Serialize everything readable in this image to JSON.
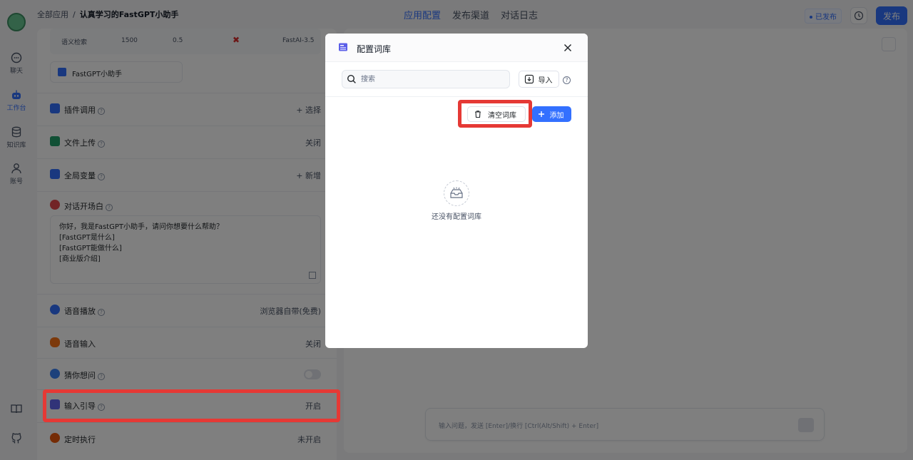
{
  "header": {
    "breadcrumb_root": "全部应用",
    "breadcrumb_sep": "/",
    "app_name": "认真学习的FastGPT小助手",
    "tabs": [
      {
        "label": "应用配置",
        "active": true
      },
      {
        "label": "发布渠道",
        "active": false
      },
      {
        "label": "对话日志",
        "active": false
      }
    ],
    "status": "已发布",
    "publish_label": "发布"
  },
  "nav": {
    "items": [
      {
        "label": "聊天",
        "icon": "chat-icon"
      },
      {
        "label": "工作台",
        "icon": "robot-icon",
        "active": true
      },
      {
        "label": "知识库",
        "icon": "database-icon"
      },
      {
        "label": "账号",
        "icon": "user-icon"
      }
    ],
    "bottom_icons": [
      "book-icon",
      "github-icon"
    ]
  },
  "config": {
    "kb_row": {
      "name": "语义检索",
      "limit": "1500",
      "similarity": "0.5",
      "rerank": "✖",
      "model": "FastAI-3.5"
    },
    "model_chip": "FastGPT小助手",
    "rows": {
      "plugin": {
        "label": "插件调用",
        "value": "+ 选择"
      },
      "file_upload": {
        "label": "文件上传",
        "value": "关闭"
      },
      "variables": {
        "label": "全局变量",
        "value": "+ 新增"
      },
      "greeting": {
        "label": "对话开场白"
      },
      "tts": {
        "label": "语音播放",
        "value": "浏览器自带(免费)"
      },
      "voice_input": {
        "label": "语音输入",
        "value": "关闭"
      },
      "guess": {
        "label": "猜你想问"
      },
      "input_guide": {
        "label": "输入引导",
        "value": "开启"
      },
      "scheduled": {
        "label": "定时执行",
        "value": "未开启"
      }
    },
    "greeting_lines": [
      "你好，我是FastGPT小助手，请问你想要什么帮助？",
      "[FastGPT是什么]",
      "[FastGPT能做什么]",
      "[商业版介绍]"
    ]
  },
  "preview": {
    "input_placeholder": "输入问题，发送 [Enter]/换行 [Ctrl(Alt/Shift) + Enter]"
  },
  "modal": {
    "title": "配置词库",
    "search_placeholder": "搜索",
    "import_label": "导入",
    "help": "?",
    "clear_label": "清空词库",
    "add_label": "添加",
    "empty_text": "还没有配置词库"
  },
  "colors": {
    "accent": "#3370ff",
    "highlight": "#e53935"
  }
}
